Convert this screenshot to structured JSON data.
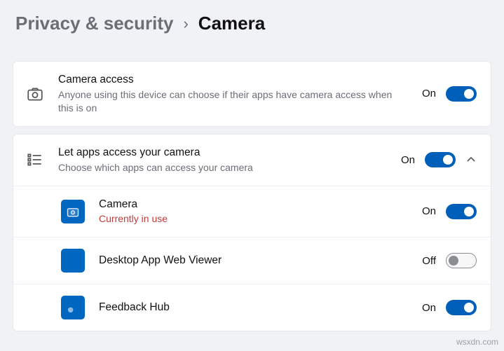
{
  "breadcrumb": {
    "parent": "Privacy & security",
    "current": "Camera"
  },
  "sections": {
    "camera_access": {
      "title": "Camera access",
      "subtitle": "Anyone using this device can choose if their apps have camera access when this is on",
      "state": "On"
    },
    "let_apps": {
      "title": "Let apps access your camera",
      "subtitle": "Choose which apps can access your camera",
      "state": "On"
    }
  },
  "apps": [
    {
      "name": "Camera",
      "status": "Currently in use",
      "state": "On"
    },
    {
      "name": "Desktop App Web Viewer",
      "status": "",
      "state": "Off"
    },
    {
      "name": "Feedback Hub",
      "status": "",
      "state": "On"
    }
  ],
  "watermark": "wsxdn.com"
}
